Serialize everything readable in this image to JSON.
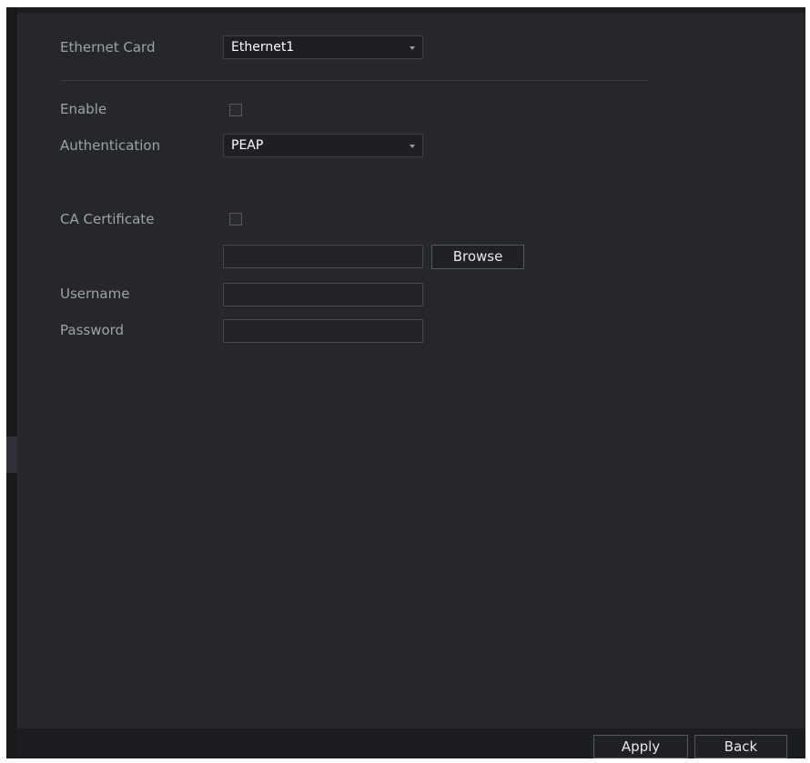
{
  "form": {
    "ethernet_card": {
      "label": "Ethernet Card",
      "value": "Ethernet1"
    },
    "enable": {
      "label": "Enable",
      "checked": false
    },
    "authentication": {
      "label": "Authentication",
      "value": "PEAP"
    },
    "ca_certificate": {
      "label": "CA Certificate",
      "checked": false,
      "file_path": "",
      "browse_label": "Browse"
    },
    "username": {
      "label": "Username",
      "value": ""
    },
    "password": {
      "label": "Password",
      "value": ""
    }
  },
  "footer": {
    "apply_label": "Apply",
    "back_label": "Back"
  },
  "colors": {
    "panel_bg": "#26272b",
    "label_text": "#9ea2a8",
    "value_text": "#ffffff",
    "field_border": "#46484d"
  }
}
